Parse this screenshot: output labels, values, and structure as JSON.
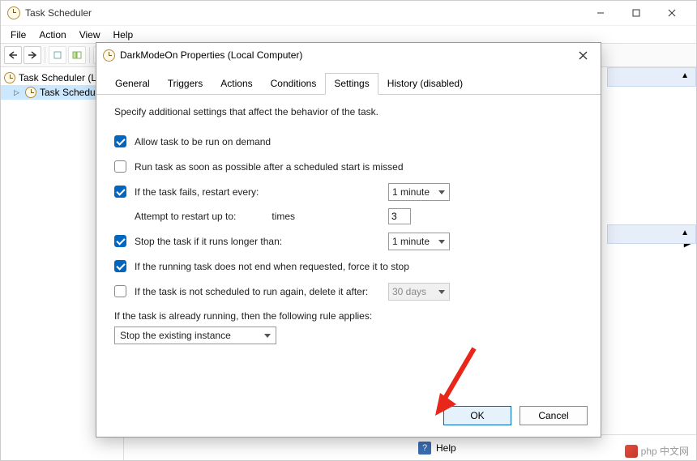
{
  "window": {
    "title": "Task Scheduler",
    "menus": [
      "File",
      "Action",
      "View",
      "Help"
    ]
  },
  "tree": {
    "root": "Task Scheduler (L",
    "child": "Task Schedul"
  },
  "status": {
    "help": "Help"
  },
  "watermark": "php 中文网",
  "dialog": {
    "title": "DarkModeOn Properties (Local Computer)",
    "tabs": [
      "General",
      "Triggers",
      "Actions",
      "Conditions",
      "Settings",
      "History (disabled)"
    ],
    "active_tab": 4,
    "intro": "Specify additional settings that affect the behavior of the task.",
    "allow_demand": "Allow task to be run on demand",
    "run_asap": "Run task as soon as possible after a scheduled start is missed",
    "restart_every": "If the task fails, restart every:",
    "restart_interval": "1 minute",
    "attempt_label": "Attempt to restart up to:",
    "attempt_value": "3",
    "attempt_times": "times",
    "stop_longer": "Stop the task if it runs longer than:",
    "stop_duration": "1 minute",
    "force_stop": "If the running task does not end when requested, force it to stop",
    "delete_after": "If the task is not scheduled to run again, delete it after:",
    "delete_duration": "30 days",
    "rule_label": "If the task is already running, then the following rule applies:",
    "rule_value": "Stop the existing instance",
    "ok": "OK",
    "cancel": "Cancel"
  }
}
